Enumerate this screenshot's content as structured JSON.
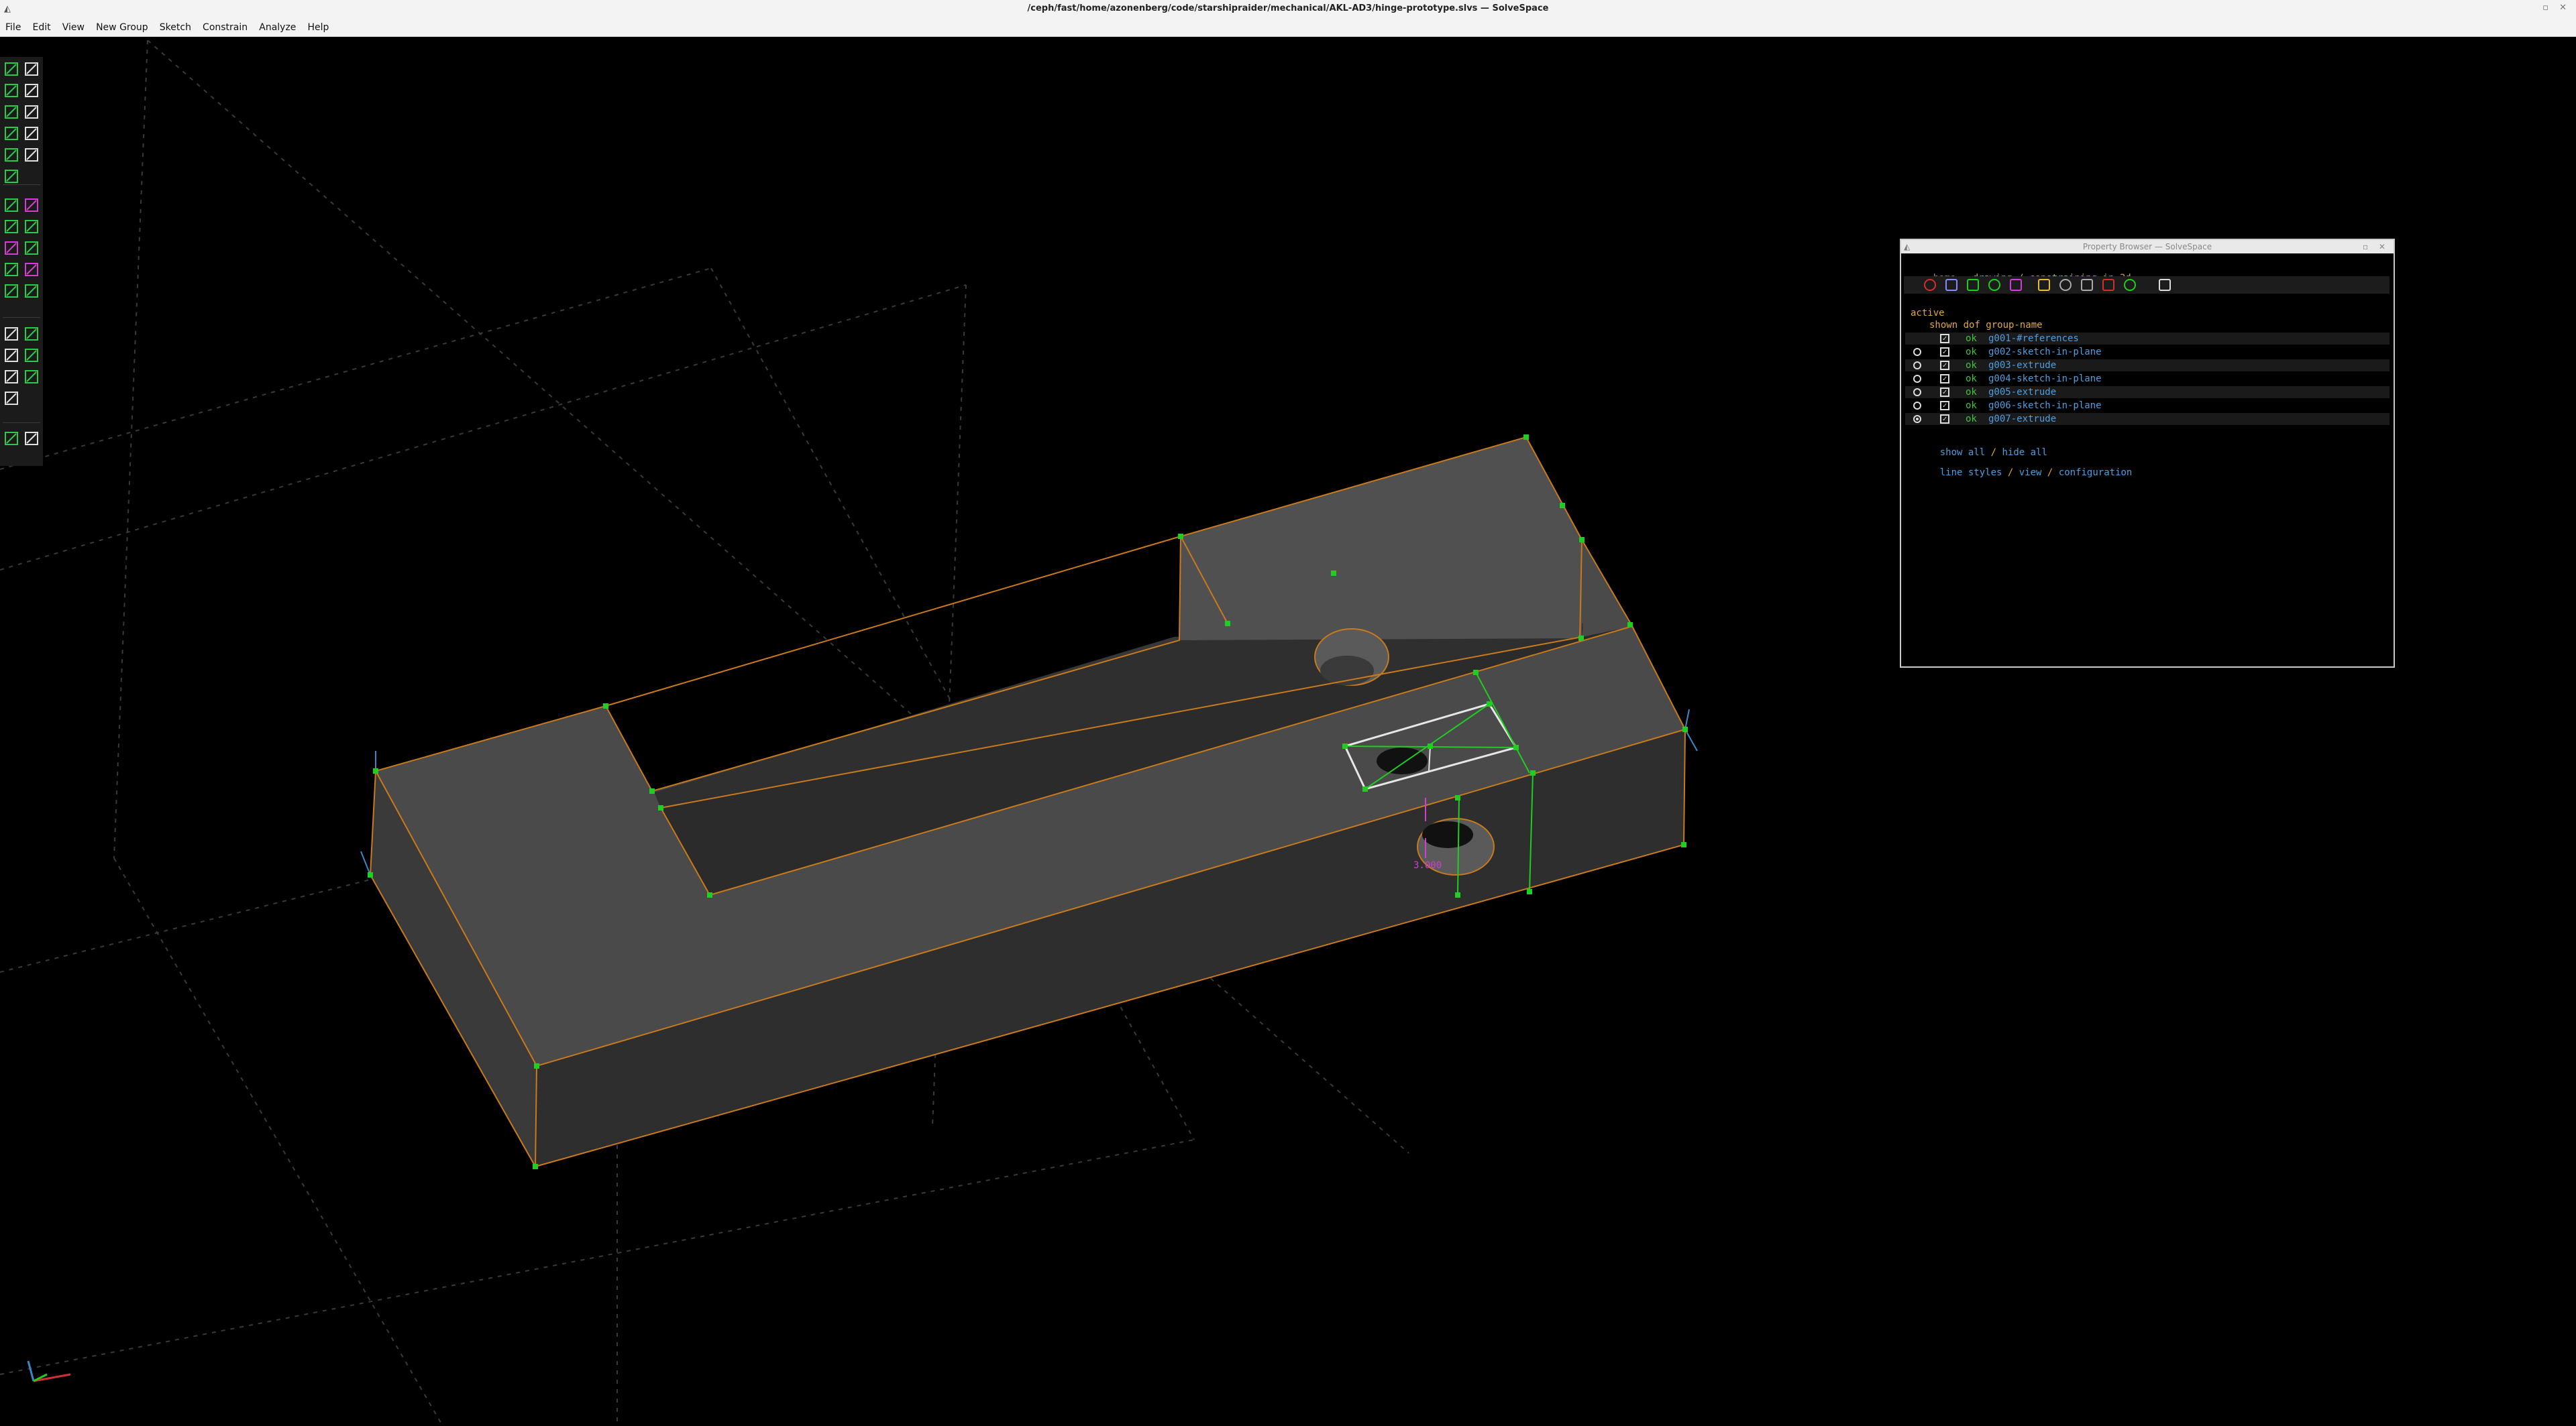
{
  "window": {
    "title": "/ceph/fast/home/azonenberg/code/starshipraider/mechanical/AKL-AD3/hinge-prototype.slvs — SolveSpace"
  },
  "menu": [
    "File",
    "Edit",
    "View",
    "New Group",
    "Sketch",
    "Constrain",
    "Analyze",
    "Help"
  ],
  "toolbar": {
    "items": [
      "line",
      "rectangle",
      "circle",
      "arc",
      "text",
      "image",
      "tangent-arc",
      "bezier",
      "point",
      "construction",
      "split",
      "distance",
      "angle",
      "horizontal",
      "vertical",
      "parallel",
      "perpendicular",
      "equal",
      "tangent",
      "point-on",
      "ref",
      "nearest-ortho",
      "nearest-iso",
      "rotate",
      "translate",
      "step-rotate",
      "step-translate",
      "workplane",
      "in-3d",
      "layer"
    ]
  },
  "viewport": {
    "dimension_label": "3.000",
    "colors": {
      "solid": "#4a4a4a",
      "edge": "#c87a1c",
      "point": "#22cc22",
      "constraint": "#d040d0",
      "grid": "#3a3a3a"
    }
  },
  "property_browser": {
    "title": "Property Browser — SolveSpace",
    "nav_home": "home",
    "nav_status": "drawing / constraining in 3d",
    "active_label": "active",
    "columns": "shown dof group-name",
    "groups": [
      {
        "radio": false,
        "shown": true,
        "status": "ok",
        "name": "g001-#references"
      },
      {
        "radio": true,
        "radio_on": false,
        "shown": true,
        "status": "ok",
        "name": "g002-sketch-in-plane"
      },
      {
        "radio": true,
        "radio_on": false,
        "shown": true,
        "status": "ok",
        "name": "g003-extrude"
      },
      {
        "radio": true,
        "radio_on": false,
        "shown": true,
        "status": "ok",
        "name": "g004-sketch-in-plane"
      },
      {
        "radio": true,
        "radio_on": false,
        "shown": true,
        "status": "ok",
        "name": "g005-extrude"
      },
      {
        "radio": true,
        "radio_on": false,
        "shown": true,
        "status": "ok",
        "name": "g006-sketch-in-plane"
      },
      {
        "radio": true,
        "radio_on": true,
        "shown": true,
        "status": "ok",
        "name": "g007-extrude"
      }
    ],
    "show_all": "show all",
    "hide_all": "hide all",
    "line_styles": "line styles",
    "view": "view",
    "configuration": "configuration",
    "slash": "/"
  }
}
